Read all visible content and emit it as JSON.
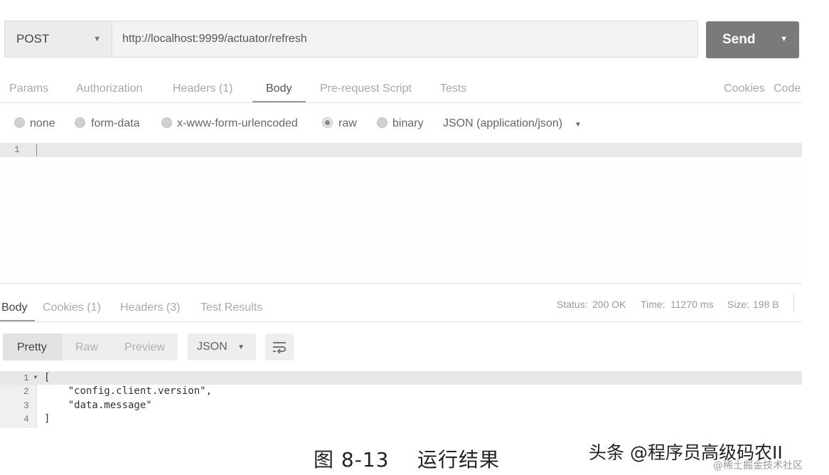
{
  "request": {
    "method": "POST",
    "url": "http://localhost:9999/actuator/refresh",
    "send_label": "Send"
  },
  "request_tabs": [
    "Params",
    "Authorization",
    "Headers (1)",
    "Body",
    "Pre-request Script",
    "Tests"
  ],
  "request_links": [
    "Cookies",
    "Code"
  ],
  "body_types": [
    "none",
    "form-data",
    "x-www-form-urlencoded",
    "raw",
    "binary"
  ],
  "body_format": "JSON (application/json)",
  "request_editor": {
    "line_number": "1"
  },
  "response_tabs": [
    "Body",
    "Cookies (1)",
    "Headers (3)",
    "Test Results"
  ],
  "status": {
    "status_label": "Status:",
    "status_value": "200 OK",
    "time_label": "Time:",
    "time_value": "11270 ms",
    "size_label": "Size:",
    "size_value": "198 B"
  },
  "view_modes": [
    "Pretty",
    "Raw",
    "Preview"
  ],
  "response_format": "JSON",
  "response_lines": [
    {
      "num": "1",
      "text": "["
    },
    {
      "num": "2",
      "text": "    \"config.client.version\","
    },
    {
      "num": "3",
      "text": "    \"data.message\""
    },
    {
      "num": "4",
      "text": "]"
    }
  ],
  "caption": "图 8-13    运行结果",
  "watermark": "头条 @程序员高级码农II",
  "watermark_sub": "@稀土掘金技术社区",
  "icons": {
    "method_dropdown": "chevron-down-icon",
    "send_dropdown": "chevron-down-icon",
    "format_dropdown": "chevron-down-icon",
    "wrap": "wrap-lines-icon",
    "fold": "fold-arrow-icon"
  }
}
